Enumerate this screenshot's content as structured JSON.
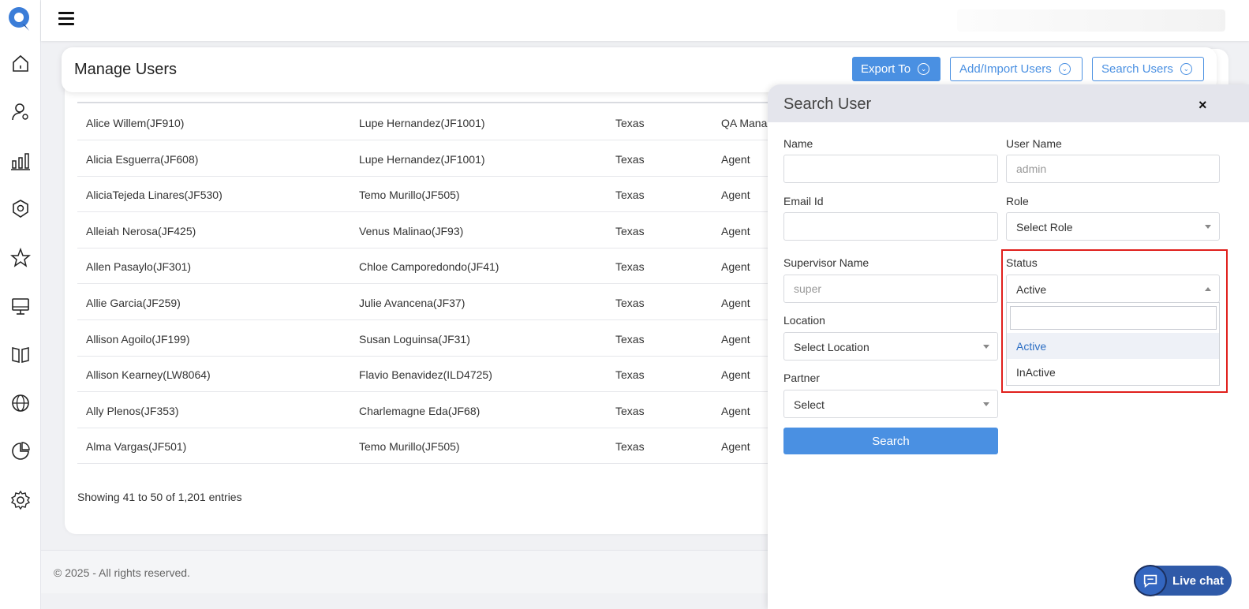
{
  "header": {
    "title": "Manage Users",
    "export_label": "Export To",
    "add_label": "Add/Import Users",
    "search_label": "Search Users"
  },
  "table": {
    "rows": [
      {
        "name": "Alice Willem(JF910)",
        "supervisor": "Lupe Hernandez(JF1001)",
        "location": "Texas",
        "role": "QA Mana"
      },
      {
        "name": "Alicia Esguerra(JF608)",
        "supervisor": "Lupe Hernandez(JF1001)",
        "location": "Texas",
        "role": "Agent"
      },
      {
        "name": "AliciaTejeda Linares(JF530)",
        "supervisor": "Temo Murillo(JF505)",
        "location": "Texas",
        "role": "Agent"
      },
      {
        "name": "Alleiah Nerosa(JF425)",
        "supervisor": "Venus Malinao(JF93)",
        "location": "Texas",
        "role": "Agent"
      },
      {
        "name": "Allen Pasaylo(JF301)",
        "supervisor": "Chloe Camporedondo(JF41)",
        "location": "Texas",
        "role": "Agent"
      },
      {
        "name": "Allie Garcia(JF259)",
        "supervisor": "Julie Avancena(JF37)",
        "location": "Texas",
        "role": "Agent"
      },
      {
        "name": "Allison Agoilo(JF199)",
        "supervisor": "Susan Loguinsa(JF31)",
        "location": "Texas",
        "role": "Agent"
      },
      {
        "name": "Allison Kearney(LW8064)",
        "supervisor": "Flavio Benavidez(ILD4725)",
        "location": "Texas",
        "role": "Agent"
      },
      {
        "name": "Ally Plenos(JF353)",
        "supervisor": "Charlemagne Eda(JF68)",
        "location": "Texas",
        "role": "Agent"
      },
      {
        "name": "Alma Vargas(JF501)",
        "supervisor": "Temo Murillo(JF505)",
        "location": "Texas",
        "role": "Agent"
      }
    ],
    "entries_text": "Showing 41 to 50 of 1,201 entries"
  },
  "footer": {
    "text": "© 2025 - All rights reserved."
  },
  "search_panel": {
    "title": "Search User",
    "close": "×",
    "name_label": "Name",
    "name_value": "",
    "username_label": "User Name",
    "username_placeholder": "admin",
    "email_label": "Email Id",
    "email_value": "",
    "role_label": "Role",
    "role_value": "Select Role",
    "supervisor_label": "Supervisor Name",
    "supervisor_placeholder": "super",
    "status_label": "Status",
    "status_value": "Active",
    "status_options": [
      "Active",
      "InActive"
    ],
    "location_label": "Location",
    "location_value": "Select Location",
    "partner_label": "Partner",
    "partner_value": "Select",
    "search_button": "Search"
  },
  "livechat": {
    "label": "Live chat"
  },
  "colors": {
    "accent": "#4a90e2",
    "highlight": "#e0201c",
    "livechat": "#2f5aa8"
  }
}
